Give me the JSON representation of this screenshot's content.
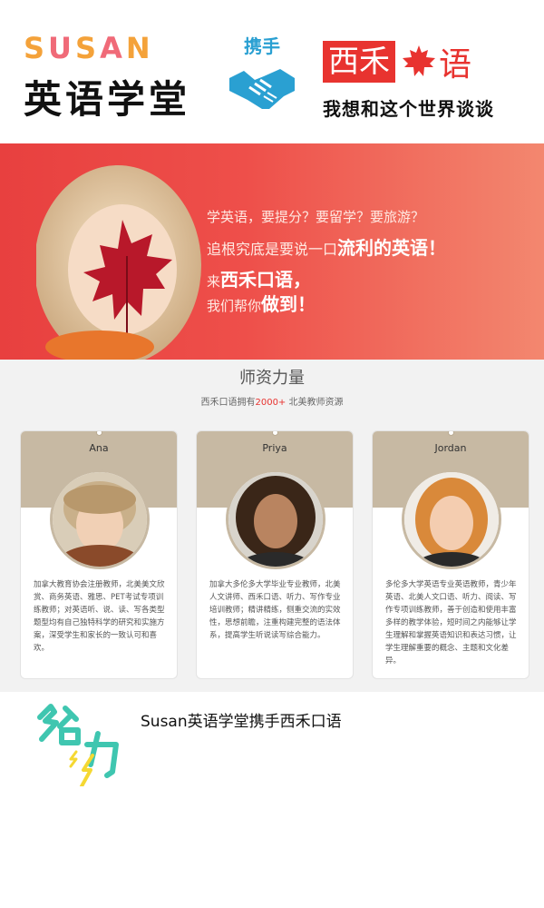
{
  "header": {
    "brand_letters": [
      "S",
      "U",
      "S",
      "A",
      "N"
    ],
    "school_name": "英语学堂",
    "partner_label": "携手",
    "partner_brand_box": "西禾",
    "partner_brand_char": "语",
    "slogan": "我想和这个世界谈谈"
  },
  "banner": {
    "line1": "学英语，要提分？要留学？要旅游？",
    "line2_prefix": "追根究底是要说一口",
    "line2_em": "流利的英语！",
    "line3_prefix": "来",
    "line3_em": "西禾口语，",
    "line4_prefix": "我们帮你",
    "line4_em": "做到！"
  },
  "teachers": {
    "title": "师资力量",
    "subtitle_prefix": "西禾口语拥有",
    "subtitle_number": "2000+",
    "subtitle_suffix": " 北美教师资源",
    "cards": [
      {
        "name": "Ana",
        "desc": "加拿大教育协会注册教师，北美美文欣赏、商务英语、雅思、PET考试专项训练教师；对英语听、说、读、写各类型题型均有自己独特科学的研究和实施方案，深受学生和家长的一致认可和喜欢。"
      },
      {
        "name": "Priya",
        "desc": "加拿大多伦多大学毕业专业教师，北美人文讲师、西禾口语、听力、写作专业培训教师；精讲精练，侧重交流的实效性，思想前瞻，注重构建完整的语法体系，提高学生听说读写综合能力。"
      },
      {
        "name": "Jordan",
        "desc": "多伦多大学英语专业英语教师，青少年英语、北美人文口语、听力、阅读、写作专项训练教师，善于创造和使用丰富多样的教学体验，短时间之内能够让学生理解和掌握英语知识和表达习惯，让学生理解重要的概念、主题和文化差异。"
      }
    ]
  },
  "footer": {
    "text": "Susan英语学堂携手西禾口语"
  },
  "colors": {
    "brand_red": "#e8332f",
    "card_tan": "#c7b9a3",
    "partner_blue": "#2aa0d2"
  }
}
